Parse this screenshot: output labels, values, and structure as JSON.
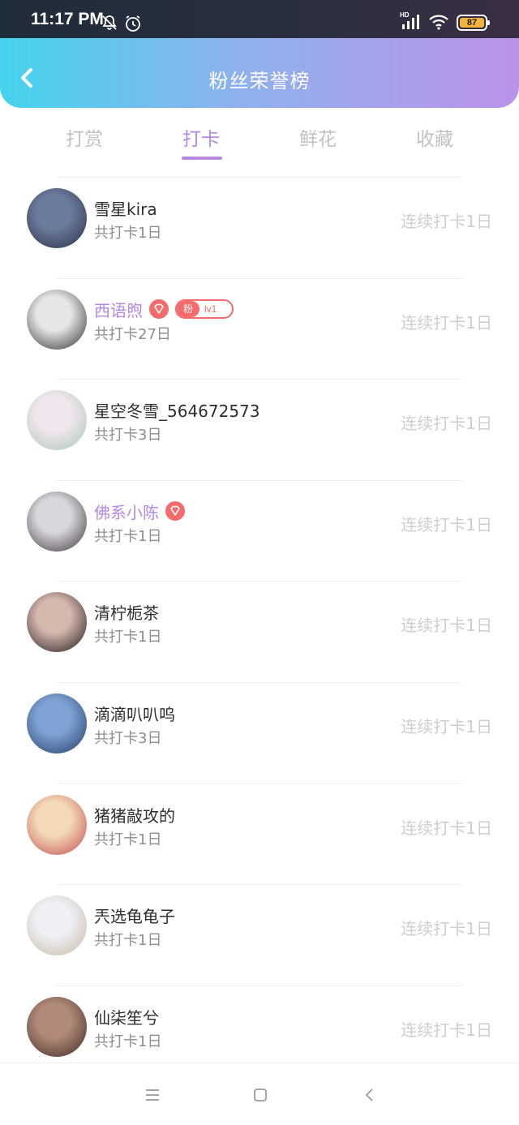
{
  "status_bar": {
    "time": "11:17 PM",
    "battery": "87",
    "network": "HD"
  },
  "header": {
    "title": "粉丝荣誉榜"
  },
  "tabs": [
    {
      "label": "打赏"
    },
    {
      "label": "打卡"
    },
    {
      "label": "鲜花"
    },
    {
      "label": "收藏"
    }
  ],
  "active_tab": "打卡",
  "list": [
    {
      "name": "雪星kira",
      "total": "共打卡1日",
      "streak": "连续打卡1日",
      "vip": false,
      "avatar_colors": [
        "#6b7b9c",
        "#2a2f44"
      ]
    },
    {
      "name": "西语煦",
      "total": "共打卡27日",
      "streak": "连续打卡1日",
      "vip": true,
      "diamond": true,
      "fan_badge": {
        "label": "粉",
        "level": "lv1"
      },
      "avatar_colors": [
        "#e6e6e6",
        "#2b2b2b"
      ]
    },
    {
      "name": "星空冬雪_564672573",
      "total": "共打卡3日",
      "streak": "连续打卡1日",
      "vip": false,
      "avatar_colors": [
        "#f2e6ee",
        "#a8c7b5"
      ]
    },
    {
      "name": "佛系小陈",
      "total": "共打卡1日",
      "streak": "连续打卡1日",
      "vip": true,
      "diamond": true,
      "avatar_colors": [
        "#d9d6dc",
        "#3a3438"
      ]
    },
    {
      "name": "清柠栀茶",
      "total": "共打卡1日",
      "streak": "连续打卡1日",
      "vip": false,
      "avatar_colors": [
        "#d4b7ad",
        "#1b1417"
      ]
    },
    {
      "name": "滴滴叭叭呜",
      "total": "共打卡3日",
      "streak": "连续打卡1日",
      "vip": false,
      "avatar_colors": [
        "#7da2d3",
        "#233b63"
      ]
    },
    {
      "name": "猪猪敲攻的",
      "total": "共打卡1日",
      "streak": "连续打卡1日",
      "vip": false,
      "avatar_colors": [
        "#f3d9b8",
        "#c24a4a"
      ]
    },
    {
      "name": "兲选龟龟子",
      "total": "共打卡1日",
      "streak": "连续打卡1日",
      "vip": false,
      "avatar_colors": [
        "#eef0f6",
        "#c8b7a0"
      ]
    },
    {
      "name": "仙柒笙兮",
      "total": "共打卡1日",
      "streak": "连续打卡1日",
      "vip": false,
      "avatar_colors": [
        "#b08978",
        "#3e2a25"
      ]
    }
  ],
  "colors": {
    "accent": "#b488e4",
    "badge": "#f56b6b",
    "header_gradient": [
      "#44d3ee",
      "#bb92ea"
    ]
  }
}
